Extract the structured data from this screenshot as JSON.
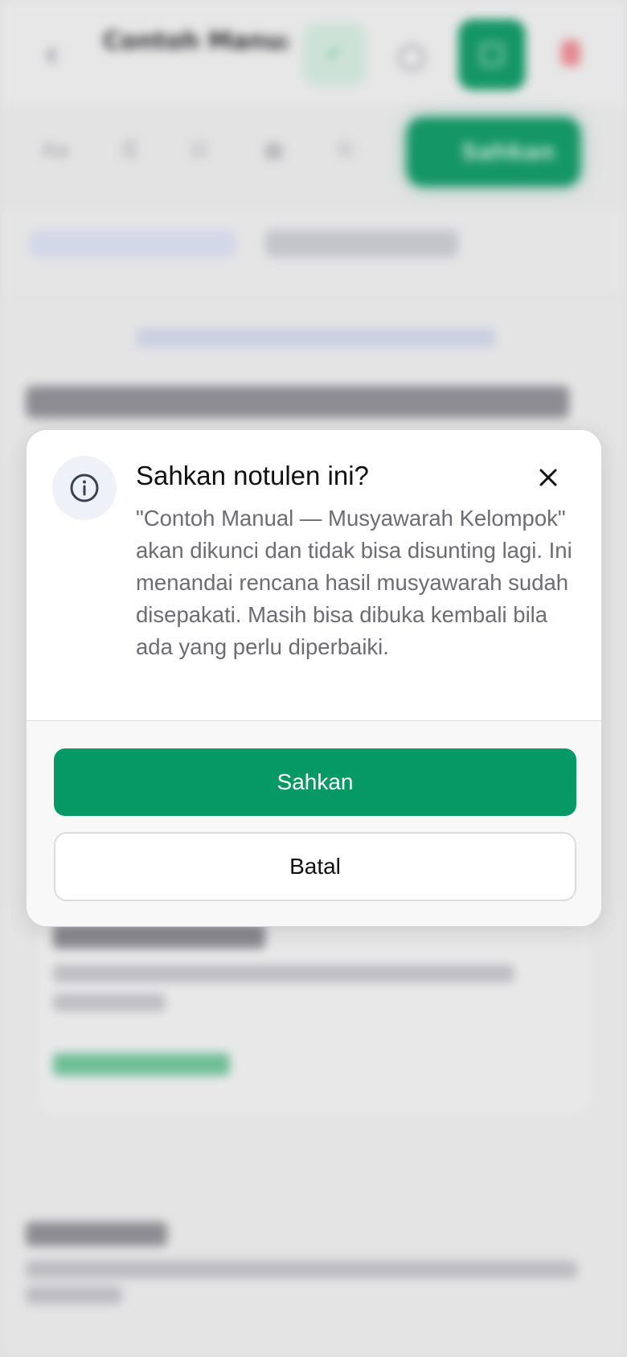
{
  "background": {
    "doc_title": "Contoh Manual...",
    "approve_label": "Sahkan"
  },
  "dialog": {
    "icon": "info-icon",
    "title": "Sahkan notulen ini?",
    "message": "\"Contoh Manual — Musyawarah Kelompok\" akan dikunci dan tidak bisa disunting lagi. Ini menandai rencana hasil musyawarah sudah disepakati. Masih bisa dibuka kembali bila ada yang perlu diperbaiki.",
    "confirm_label": "Sahkan",
    "cancel_label": "Batal",
    "close_icon": "close-icon"
  },
  "colors": {
    "primary": "#069966",
    "danger": "#f38e94"
  }
}
